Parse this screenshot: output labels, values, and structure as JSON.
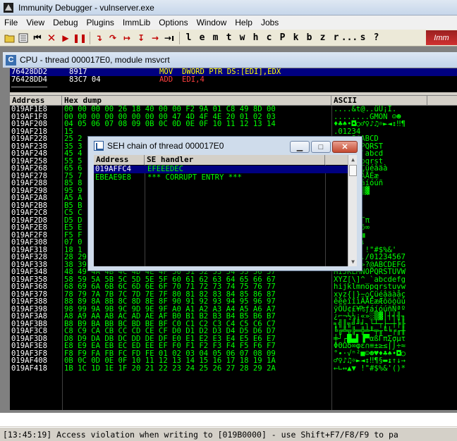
{
  "app": {
    "title": "Immunity Debugger - vulnserver.exe"
  },
  "menu": [
    "File",
    "View",
    "Debug",
    "Plugins",
    "ImmLib",
    "Options",
    "Window",
    "Help",
    "Jobs"
  ],
  "toolbar": {
    "letters": [
      "l",
      "e",
      "m",
      "t",
      "w",
      "h",
      "c",
      "P",
      "k",
      "b",
      "z",
      "r",
      "...",
      "s",
      "?"
    ],
    "tag": "Imm"
  },
  "cpu_window": {
    "title": "CPU - thread 000017E0, module msvcrt"
  },
  "disasm": [
    {
      "addr": "76428DD2",
      "hex": "8917",
      "mnem": "MOV",
      "ops": "DWORD PTR DS:[EDI],EDX",
      "selected": true
    },
    {
      "addr": "76428DD4",
      "hex": "83C7 04",
      "mnem": "ADD",
      "ops": "EDI,4",
      "selected": false
    }
  ],
  "dump": {
    "headers": [
      "Address",
      "Hex dump",
      "ASCII"
    ],
    "rows": [
      {
        "a": "019AF1E8",
        "h": "00 00 00 00 26 18 40 00 00 F2 9A 01 C8 49 8D 00",
        "s": "....&t@..üÚ¡I."
      },
      {
        "a": "019AF1F8",
        "h": "00 00 00 00 00 00 00 00 47 4D 4F 4E 20 01 02 03",
        "s": "........GMON ☺☻"
      },
      {
        "a": "019AF208",
        "h": "04 05 06 07 08 09 0B 0C 0D 0E 0F 10 11 12 13 14",
        "s": "♦♣♠•◘○♂♀♪♫☼►◄↕‼¶"
      },
      {
        "a": "019AF218",
        "h": "15",
        "s": ".01234"
      },
      {
        "a": "019AF228",
        "h": "25 2",
        "s": ";<=>?@ABCD"
      },
      {
        "a": "019AF238",
        "h": "35 3",
        "s": "JKLMNOPQRST"
      },
      {
        "a": "019AF248",
        "h": "45 4",
        "s": "Z[\\]^_`abcd"
      },
      {
        "a": "019AF258",
        "h": "55 5",
        "s": "jklmnopqrst"
      },
      {
        "a": "019AF268",
        "h": "65 6",
        "s": "z{|}~⌂Çüéâäà"
      },
      {
        "a": "019AF278",
        "h": "75 7",
        "s": "êëèïîìÄÅÉæ"
      },
      {
        "a": "019AF288",
        "h": "85 8",
        "s": "Ü¢£¥₧ƒáíóúñ"
      },
      {
        "a": "019AF298",
        "h": "95 9",
        "s": "½¼¡«»░▒▓"
      },
      {
        "a": "019AF2A8",
        "h": "A5 A",
        "s": "╟╚╔╩╦╠"
      },
      {
        "a": "019AF2B8",
        "h": "B5 B",
        "s": "╣║╗╝╜╛"
      },
      {
        "a": "019AF2C8",
        "h": "C5 C",
        "s": "╞╟╚╔╩╦"
      },
      {
        "a": "019AF2D8",
        "h": "D5 D",
        "s": "▄▌▐▀αßΓπ"
      },
      {
        "a": "019AF2E8",
        "h": "E5 E",
        "s": "σµτΦΘΩδ∞"
      },
      {
        "a": "019AF2F8",
        "h": "F5 F",
        "s": "°∙·√ⁿ²■"
      },
      {
        "a": "019AF308",
        "h": "07 0",
        "s": "‡¶§▬↨↑↓"
      },
      {
        "a": "019AF318",
        "h": "18 1",
        "s": "→←∟↔▲▼ !\"#$%&'"
      },
      {
        "a": "019AF328",
        "h": "28 29 2A 2B 2C 2D 2E 2F 30 31 32 33 34 35 36 37",
        "s": "()*+,-./01234567"
      },
      {
        "a": "019AF338",
        "h": "38 39 3A 3B 3C 3D 3E 3F 40 41 42 43 44 45 46 47",
        "s": "89:;<=>?@ABCDEFG"
      },
      {
        "a": "019AF348",
        "h": "48 49 4A 4B 4C 4D 4E 4F 50 51 52 53 54 55 56 57",
        "s": "HIJKLMNOPQRSTUVW"
      },
      {
        "a": "019AF358",
        "h": "58 59 5A 5B 5C 5D 5E 5F 60 61 62 63 64 65 66 67",
        "s": "XYZ[\\]^_`abcdefg"
      },
      {
        "a": "019AF368",
        "h": "68 69 6A 6B 6C 6D 6E 6F 70 71 72 73 74 75 76 77",
        "s": "hijklmnopqrstuvw"
      },
      {
        "a": "019AF378",
        "h": "78 79 7A 7B 7C 7D 7E 7F 80 81 82 83 84 85 86 87",
        "s": "xyz{|}~⌂Çüéâäàåç"
      },
      {
        "a": "019AF388",
        "h": "88 89 8A 8B 8C 8D 8E 8F 90 91 92 93 94 95 96 97",
        "s": "êëèïîìÄÅÉæÆôöòûù"
      },
      {
        "a": "019AF398",
        "h": "98 99 9A 9B 9C 9D 9E 9F A0 A1 A2 A3 A4 A5 A6 A7",
        "s": "ÿÖÜ¢£¥₧ƒáíóúñÑªº"
      },
      {
        "a": "019AF3A8",
        "h": "A8 A9 AA AB AC AD AE AF B0 B1 B2 B3 B4 B5 B6 B7",
        "s": "¿⌐¬½¼¡«»░▒▓│┤╡╢╖"
      },
      {
        "a": "019AF3B8",
        "h": "B8 B9 BA BB BC BD BE BF C0 C1 C2 C3 C4 C5 C6 C7",
        "s": "╕╣║╗╝╜╛┐└┴┬├─┼╞╟"
      },
      {
        "a": "019AF3C8",
        "h": "C8 C9 CA CB CC CD CE CF D0 D1 D2 D3 D4 D5 D6 D7",
        "s": "╚╔╩╦╠═╬╧╨╤╥╙╘╒╓╫"
      },
      {
        "a": "019AF3D8",
        "h": "D8 D9 DA DB DC DD DE DF E0 E1 E2 E3 E4 E5 E6 E7",
        "s": "╪┘┌█▄▌▐▀αßΓπΣσµτ"
      },
      {
        "a": "019AF3E8",
        "h": "E8 E9 EA EB EC ED EE EF F0 F1 F2 F3 F4 F5 F6 F7",
        "s": "ΦΘΩδ∞φε∩≡±≥≤⌠⌡÷≈"
      },
      {
        "a": "019AF3F8",
        "h": "F8 F9 FA FB FC FD FE 01 02 03 04 05 06 07 08 09",
        "s": "°∙·√ⁿ²■☺☻♥♦♣♠•◘○"
      },
      {
        "a": "019AF408",
        "h": "0B 0C 0D 0E 0F 10 11 12 13 14 15 16 17 18 19 1A",
        "s": "♂♀♪♫☼►◄↕‼¶§▬↨↑↓→"
      },
      {
        "a": "019AF418",
        "h": "1B 1C 1D 1E 1F 20 21 22 23 24 25 26 27 28 29 2A",
        "s": "←∟↔▲▼ !\"#$%&'()*"
      }
    ]
  },
  "seh_window": {
    "title": "SEH chain of thread 000017E0",
    "headers": [
      "Address",
      "SE handler"
    ],
    "rows": [
      {
        "addr": "019AFFC4",
        "handler": "EFEEEDEC",
        "selected": true
      },
      {
        "addr": "EBEAE9E8",
        "handler": "*** CORRUPT ENTRY ***",
        "selected": false
      }
    ]
  },
  "status": {
    "text": "[13:45:19] Access violation when writing to [019B0000] - use Shift+F7/F8/F9 to pa"
  },
  "colors": {
    "dump_bg": "#000000",
    "dump_text": "#00ff00",
    "address_text": "#ffffff",
    "selection": "#000080",
    "mnemonic": "#ffff00"
  }
}
